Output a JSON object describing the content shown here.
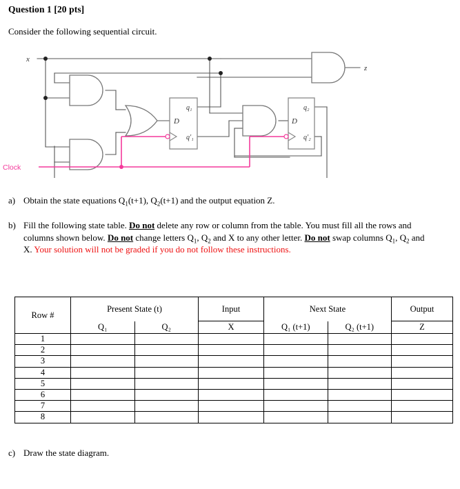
{
  "question": {
    "title": "Question 1 [20 pts]",
    "intro": "Consider the following sequential circuit."
  },
  "circuit": {
    "input_label": "x",
    "output_label": "z",
    "clock_label": "Clock",
    "clock_color": "#f4399b",
    "wire_color": "#555555",
    "ff1": {
      "d_label": "D",
      "q_label": "q₁",
      "qbar_label": "q₁′"
    },
    "ff2": {
      "d_label": "D",
      "q_label": "q₂",
      "qbar_label": "q₂′"
    },
    "gates": [
      "and",
      "and",
      "or",
      "and",
      "and"
    ]
  },
  "parts": {
    "a": {
      "marker": "a)",
      "text_1": "Obtain the state equations Q",
      "sub_1": "1",
      "text_2": "(t+1), Q",
      "sub_2": "2",
      "text_3": "(t+1) and the output equation Z."
    },
    "b": {
      "marker": "b)",
      "s1": "Fill the following state table. ",
      "donot_1": "Do not",
      "s2": " delete any row or column from the table. You must fill all the rows and columns shown below. ",
      "donot_2": "Do not",
      "s3": " change letters Q",
      "sub_1": "1",
      "s4": ", Q",
      "sub_2": "2",
      "s5": " and X to any other letter. ",
      "donot_3": "Do not",
      "s6": " swap columns Q",
      "sub_3": "1",
      "s7": ", Q",
      "sub_4": "2",
      "s8": " and X. ",
      "red": "Your solution will not be graded if you do not follow these instructions.",
      "red_color": "#ee1111"
    },
    "c": {
      "marker": "c)",
      "text": "Draw the state diagram."
    }
  },
  "table": {
    "group_headers": {
      "row_num": "Row #",
      "present_state": "Present State (t)",
      "input": "Input",
      "next_state": "Next State",
      "output": "Output"
    },
    "sub_headers": {
      "q1": "Q₁",
      "q2": "Q₂",
      "x": "X",
      "q1_next": "Q₁ (t+1)",
      "q2_next": "Q₂ (t+1)",
      "z": "Z"
    },
    "rows": [
      {
        "num": "1",
        "q1": "",
        "q2": "",
        "x": "",
        "q1_next": "",
        "q2_next": "",
        "z": ""
      },
      {
        "num": "2",
        "q1": "",
        "q2": "",
        "x": "",
        "q1_next": "",
        "q2_next": "",
        "z": ""
      },
      {
        "num": "3",
        "q1": "",
        "q2": "",
        "x": "",
        "q1_next": "",
        "q2_next": "",
        "z": ""
      },
      {
        "num": "4",
        "q1": "",
        "q2": "",
        "x": "",
        "q1_next": "",
        "q2_next": "",
        "z": ""
      },
      {
        "num": "5",
        "q1": "",
        "q2": "",
        "x": "",
        "q1_next": "",
        "q2_next": "",
        "z": ""
      },
      {
        "num": "6",
        "q1": "",
        "q2": "",
        "x": "",
        "q1_next": "",
        "q2_next": "",
        "z": ""
      },
      {
        "num": "7",
        "q1": "",
        "q2": "",
        "x": "",
        "q1_next": "",
        "q2_next": "",
        "z": ""
      },
      {
        "num": "8",
        "q1": "",
        "q2": "",
        "x": "",
        "q1_next": "",
        "q2_next": "",
        "z": ""
      }
    ]
  }
}
